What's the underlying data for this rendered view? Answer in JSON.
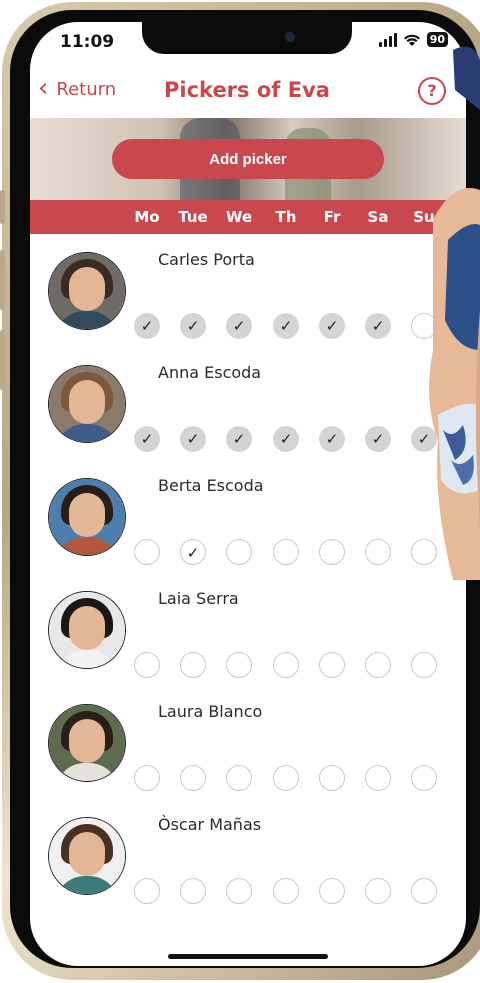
{
  "status_bar": {
    "time": "11:09",
    "battery": "90"
  },
  "nav": {
    "back_label": "Return",
    "title": "Pickers of Eva",
    "help_icon": "?"
  },
  "actions": {
    "add_picker_label": "Add picker"
  },
  "days": [
    "Mo",
    "Tue",
    "We",
    "Th",
    "Fr",
    "Sa",
    "Su"
  ],
  "pickers": [
    {
      "name": "Carles Porta",
      "days": [
        true,
        true,
        true,
        true,
        true,
        true,
        false
      ]
    },
    {
      "name": "Anna Escoda",
      "days": [
        true,
        true,
        true,
        true,
        true,
        true,
        true
      ]
    },
    {
      "name": "Berta Escoda",
      "days": [
        false,
        true,
        false,
        false,
        false,
        false,
        false
      ]
    },
    {
      "name": "Laia Serra",
      "days": [
        false,
        false,
        false,
        false,
        false,
        false,
        false
      ]
    },
    {
      "name": "Laura Blanco",
      "days": [
        false,
        false,
        false,
        false,
        false,
        false,
        false
      ]
    },
    {
      "name": "Òscar Mañas",
      "days": [
        false,
        false,
        false,
        false,
        false,
        false,
        false
      ]
    }
  ],
  "colors": {
    "accent": "#c8484e",
    "check_fill": "#d4d4d4"
  }
}
